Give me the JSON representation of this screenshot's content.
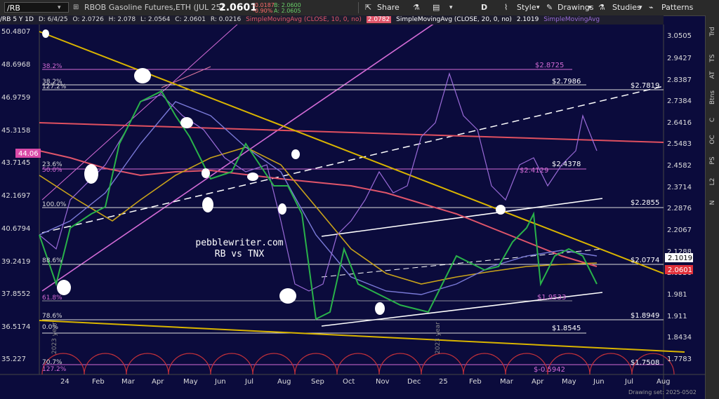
{
  "toolbar": {
    "symbol": "/RB",
    "instrument": "RBOB Gasoline Futures,ETH (JUL 25)",
    "last_price": "2.0601",
    "change": "-0.0187",
    "change_pct": "-0.90%",
    "bid": "B: 2.0600",
    "ask": "A: 2.0605",
    "share_label": "Share",
    "period_label": "D",
    "style_label": "Style",
    "drawings_label": "Drawings",
    "studies_label": "Studies",
    "patterns_label": "Patterns"
  },
  "info_bar": {
    "ticker": "/RB 5 Y 1D",
    "date": "D: 6/4/25",
    "open": "O: 2.0726",
    "high": "H: 2.078",
    "low": "L: 2.0564",
    "close": "C: 2.0601",
    "range": "R: 0.0216",
    "sma10_label": "SimpleMovingAvg (CLOSE, 10, 0, no)",
    "sma10_value": "2.0782",
    "sma20_label": "SimpleMovingAvg (CLOSE, 20, 0, no)",
    "sma20_value": "2.1019",
    "sma_extra": "SimpleMovingAvg"
  },
  "right_strip": [
    "Trd",
    "TS",
    "AT",
    "Btns",
    "C",
    "OC",
    "PS",
    "L2",
    "N"
  ],
  "price_axis": [
    "3.0505",
    "2.9427",
    "2.8387",
    "2.7384",
    "2.6416",
    "2.5483",
    "2.4582",
    "2.3714",
    "2.2876",
    "2.2067",
    "2.1288",
    "2.0536",
    "1.981",
    "1.911",
    "1.8434",
    "1.7783"
  ],
  "price_tags": {
    "sma20": "2.1019",
    "last": "2.0601"
  },
  "left_axis": [
    "50.4807",
    "48.6968",
    "46.9759",
    "45.3158",
    "43.7145",
    "42.1697",
    "40.6794",
    "39.2419",
    "37.8552",
    "36.5174",
    "35.227"
  ],
  "left_tag": "44.06",
  "date_axis": [
    "24",
    "Feb",
    "Mar",
    "Apr",
    "May",
    "Jun",
    "Jul",
    "Aug",
    "Sep",
    "Oct",
    "Nov",
    "Dec",
    "25",
    "Feb",
    "Mar",
    "Apr",
    "May",
    "Jun",
    "Jul",
    "Aug"
  ],
  "left_fib": [
    "38.2%",
    "38.2%",
    "127.2%",
    "23.6%",
    "50.0%",
    "100.0%",
    "88.6%",
    "61.8%",
    "78.6%",
    "0.0%",
    "70.7%",
    "127.2%"
  ],
  "level_labels": [
    "$2.8725",
    "$2.7986",
    "$2.7819",
    "$2.4378",
    "$2.4129",
    "$2.2855",
    "$2.0774",
    "$1.9533",
    "$1.8949",
    "$1.8545",
    "$1.7508",
    "$-0.5942"
  ],
  "watermark": {
    "line1": "pebblewriter.com",
    "line2": "RB vs TNX"
  },
  "vertical_labels": [
    "2023 year",
    "2023 year"
  ],
  "bottom_right": "Drawing set: 2025-0502",
  "colors": {
    "fan_yellow": "#d9b400",
    "red_line": "#e0556a",
    "magenta": "#d36bd6",
    "tnx": "#9a6bd8",
    "background": "#0b0b3c"
  }
}
